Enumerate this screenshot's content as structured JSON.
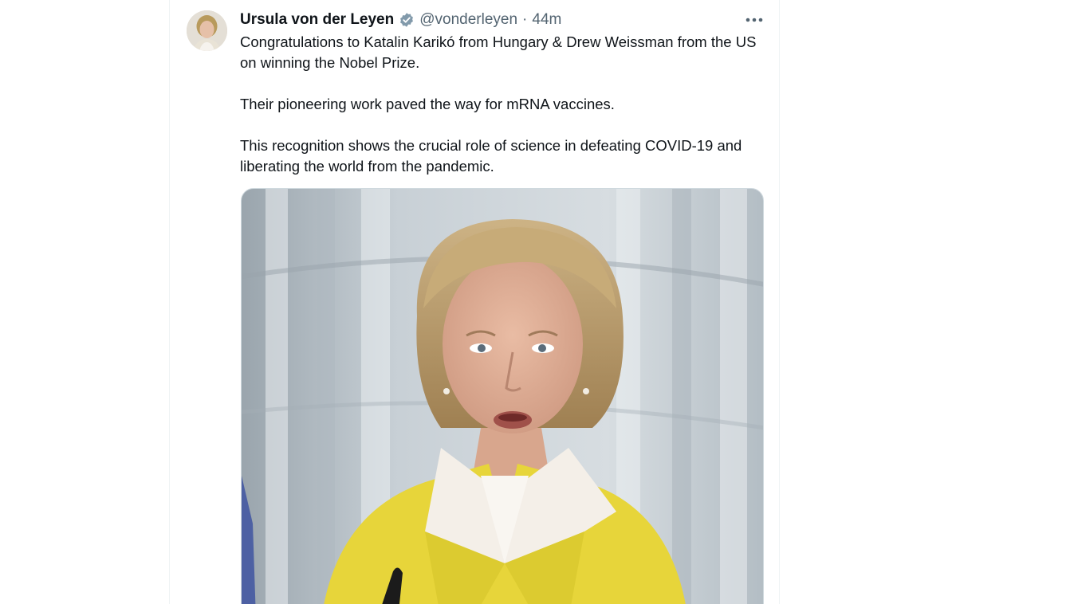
{
  "tweet": {
    "author_name": "Ursula von der Leyen",
    "handle": "@vonderleyen",
    "separator": "·",
    "time": "44m",
    "paragraphs": [
      "Congratulations to Katalin Karikó from Hungary & Drew Weissman from the US on winning the Nobel Prize.",
      "Their pioneering work paved the way for mRNA vaccines.",
      "This recognition shows the crucial role of science in defeating COVID-19 and liberating the world from the pandemic."
    ]
  },
  "icons": {
    "verified": "verified-badge-icon",
    "more": "more-options-icon"
  },
  "colors": {
    "text_primary": "#0f1419",
    "text_secondary": "#536471",
    "verified_badge": "#829aab",
    "jacket": "#e7d53a"
  }
}
